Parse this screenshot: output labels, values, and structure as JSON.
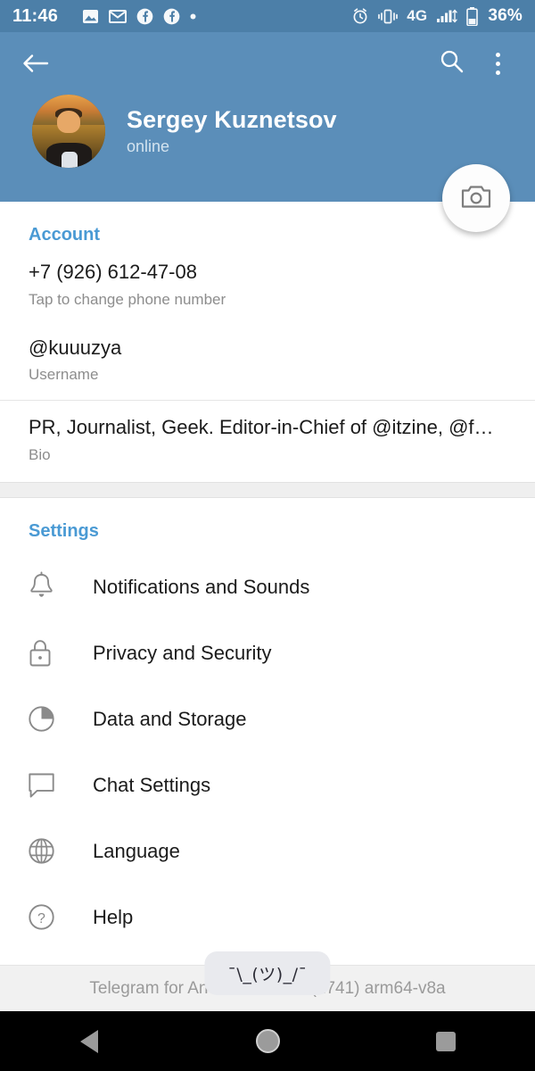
{
  "status_bar": {
    "time": "11:46",
    "left_icons": [
      "image-icon",
      "mail-icon",
      "facebook-icon",
      "facebook-icon",
      "dot-icon"
    ],
    "right_icons": [
      "alarm-icon",
      "vibrate-icon",
      "signal-icon"
    ],
    "network": "4G",
    "battery_percent": "36%",
    "background_color": "#4c7fa8"
  },
  "app_bar": {
    "back_label": "Back",
    "search_label": "Search",
    "menu_label": "More options",
    "profile_name": "Sergey Kuznetsov",
    "profile_status": "online",
    "camera_button_label": "Change photo",
    "background_color": "#5b8eb9"
  },
  "account": {
    "title": "Account",
    "accent_color": "#4a9ad4",
    "rows": [
      {
        "value": "+7 (926) 612-47-08",
        "label": "Tap to change phone number"
      },
      {
        "value": "@kuuuzya",
        "label": "Username"
      },
      {
        "value": "PR, Journalist, Geek. Editor-in-Chief of @itzine, @f…",
        "label": "Bio"
      }
    ]
  },
  "settings": {
    "title": "Settings",
    "items": [
      {
        "label": "Notifications and Sounds",
        "icon": "bell-icon"
      },
      {
        "label": "Privacy and Security",
        "icon": "lock-icon"
      },
      {
        "label": "Data and Storage",
        "icon": "pie-chart-icon"
      },
      {
        "label": "Chat Settings",
        "icon": "chat-bubble-icon"
      },
      {
        "label": "Language",
        "icon": "globe-icon"
      },
      {
        "label": "Help",
        "icon": "question-mark-icon"
      }
    ]
  },
  "toast": {
    "text": "¯\\_(ツ)_/¯"
  },
  "footer": {
    "version": "Telegram for Android v5.12.0 (1741) arm64-v8a"
  },
  "nav_bar": {
    "back_label": "Back",
    "home_label": "Home",
    "recents_label": "Recents"
  }
}
